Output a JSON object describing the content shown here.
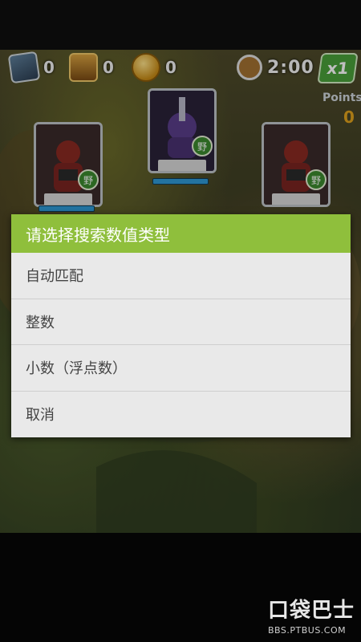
{
  "hud": {
    "cards_count": "0",
    "chest_count": "0",
    "coins_count": "0",
    "timer": "2:00",
    "multiplier": "x1",
    "points_label": "Points",
    "points_value": "0"
  },
  "units": [
    {
      "name": "red-orc",
      "badge": "野"
    },
    {
      "name": "purple-beast",
      "badge": "野"
    },
    {
      "name": "red-orc",
      "badge": "野"
    }
  ],
  "dialog": {
    "title": "请选择搜索数值类型",
    "options": [
      {
        "label": "自动匹配"
      },
      {
        "label": "整数"
      },
      {
        "label": "小数（浮点数）"
      },
      {
        "label": "取消"
      }
    ]
  },
  "colors": {
    "dialog_header": "#8fbf3c",
    "dialog_body": "#e9e9e9",
    "option_text": "#444444"
  },
  "watermark": {
    "logo": "口袋巴士",
    "url": "BBS.PTBUS.COM"
  }
}
